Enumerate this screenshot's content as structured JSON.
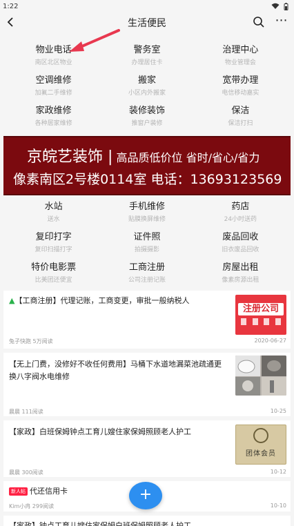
{
  "status": {
    "time": "1:22"
  },
  "header": {
    "title": "生活便民"
  },
  "grid1": [
    {
      "t": "物业电话",
      "s": "南区北区物业"
    },
    {
      "t": "警务室",
      "s": "办理居住卡"
    },
    {
      "t": "治理中心",
      "s": "物业管理会"
    },
    {
      "t": "空调维修",
      "s": "加氟二手维修"
    },
    {
      "t": "搬家",
      "s": "小区内外搬家"
    },
    {
      "t": "宽带办理",
      "s": "电信移动嘉实"
    },
    {
      "t": "家政维修",
      "s": "各种居家维修"
    },
    {
      "t": "装修装饰",
      "s": "推窗户装修"
    },
    {
      "t": "保洁",
      "s": "保洁打扫"
    }
  ],
  "banner": {
    "line1_main": "京皖艺装饰 |",
    "line1_sub": " 高品质低价位 省时/省心/省力",
    "line2": "像素南区2号楼0114室    电话：13693123569"
  },
  "grid2": [
    {
      "t": "水站",
      "s": "送水"
    },
    {
      "t": "手机维修",
      "s": "贴膜换屏维修"
    },
    {
      "t": "药店",
      "s": "24小时送药"
    },
    {
      "t": "复印打字",
      "s": "复印扫描打字"
    },
    {
      "t": "证件照",
      "s": "拍摄摄影"
    },
    {
      "t": "废品回收",
      "s": "旧衣废品回收"
    },
    {
      "t": "特价电影票",
      "s": "比美团还便宜"
    },
    {
      "t": "工商注册",
      "s": "公司注册记账"
    },
    {
      "t": "房屋出租",
      "s": "像素房源出租"
    }
  ],
  "feed": [
    {
      "title": "【工商注册】代理记账，工商变更，审批一般纳税人",
      "meta": "兔子快跑 5万阅读",
      "date": "2020-06-27",
      "thumb_text": "注册公司"
    },
    {
      "title": "【无上门费，没修好不收任何费用】马桶下水道地漏菜池疏通更换八字阀水电维修",
      "meta": "晨晨 111阅读",
      "date": "10-25"
    },
    {
      "title": "【家政】白班保姆钟点工育儿嫂住家保姆照顾老人护工",
      "meta": "晨晨 300阅读",
      "date": "10-12",
      "thumb_text": "团体会员"
    },
    {
      "tag": "新人帖",
      "title": "代还信用卡",
      "meta": "Kim小冉 299阅读",
      "date": "10-10"
    },
    {
      "title": "【家政】钟点工育儿嫂住家保姆白班保姆照顾老人护工"
    }
  ],
  "colors": {
    "banner": "#7b0a0f",
    "fab": "#2d8ff0",
    "arrow": "#e8384f"
  },
  "fab_label": "+"
}
